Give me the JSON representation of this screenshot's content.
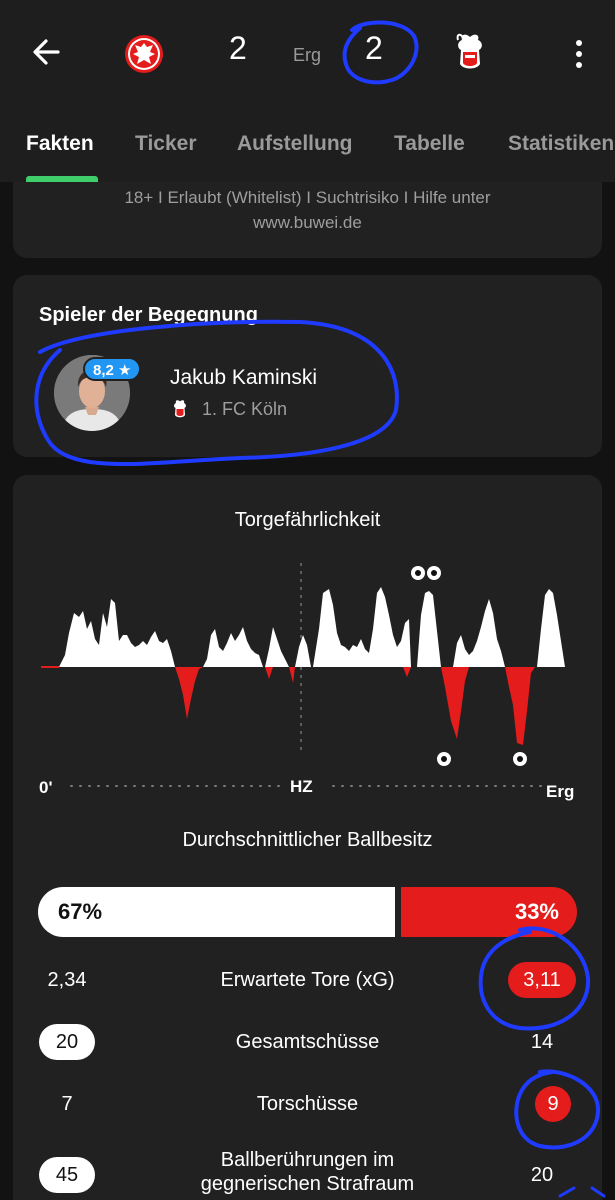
{
  "header": {
    "home_score": "2",
    "status": "Erg",
    "away_score": "2",
    "home_crest_icon": "eintracht-frankfurt-eagle-crest-icon",
    "away_crest_icon": "fc-koeln-goat-crest-icon"
  },
  "tabs": [
    {
      "label": "Fakten"
    },
    {
      "label": "Ticker"
    },
    {
      "label": "Aufstellung"
    },
    {
      "label": "Tabelle"
    },
    {
      "label": "Statistiken"
    }
  ],
  "disclaimer": {
    "line1": "18+ I Erlaubt (Whitelist) I Suchtrisiko I Hilfe unter",
    "line2": "www.buwei.de"
  },
  "player_of_match": {
    "title": "Spieler der Begegnung",
    "rating": "8,2 ★",
    "name": "Jakub Kaminski",
    "club": "1. FC Köln"
  },
  "threat_chart": {
    "title": "Torgefährlichkeit",
    "start_label": "0'",
    "half_label": "HZ",
    "end_label": "Erg"
  },
  "chart_data": {
    "type": "area",
    "title": "Torgefährlichkeit",
    "x_labels": [
      "0'",
      "HZ",
      "Erg"
    ],
    "home_color": "#ffffff",
    "away_color": "#e41c1c",
    "home_goals_at_peak_count": 2,
    "away_goals_marked": 2
  },
  "possession": {
    "title": "Durchschnittlicher Ballbesitz",
    "home_label": "67%",
    "away_label": "33%",
    "home_value": 67,
    "away_value": 33
  },
  "stat_rows": [
    {
      "label": "Erwartete Tore (xG)",
      "home": "2,34",
      "away": "3,11",
      "home_style": "plain",
      "away_style": "red"
    },
    {
      "label": "Gesamtschüsse",
      "home": "20",
      "away": "14",
      "home_style": "white",
      "away_style": "plain"
    },
    {
      "label": "Torschüsse",
      "home": "7",
      "away": "9",
      "home_style": "plain",
      "away_style": "red"
    },
    {
      "label": "Ballberührungen im gegnerischen Strafraum",
      "home": "45",
      "away": "20",
      "home_style": "white",
      "away_style": "plain"
    }
  ],
  "colors": {
    "accent_green": "#3fce6a",
    "away_red": "#e41c1c",
    "rating_blue": "#2196f3",
    "annotation_blue": "#1f3bff"
  }
}
